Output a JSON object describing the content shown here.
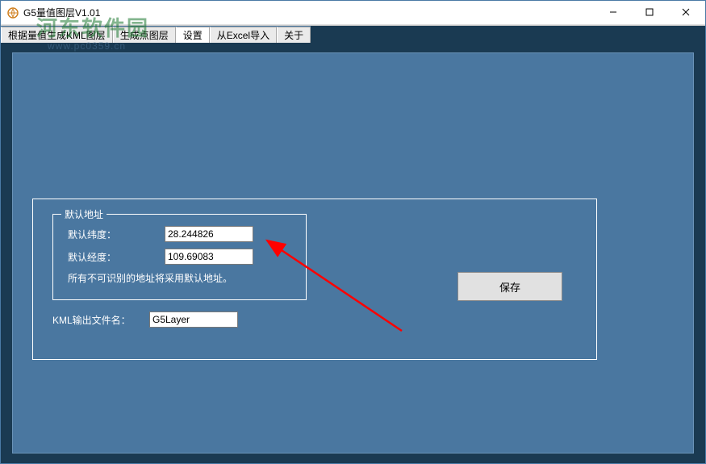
{
  "window": {
    "title": "G5量值图层V1.01"
  },
  "tabs": [
    {
      "label": "根据量值生成KML图层",
      "active": false
    },
    {
      "label": "生成点图层",
      "active": false
    },
    {
      "label": "设置",
      "active": true
    },
    {
      "label": "从Excel导入",
      "active": false
    },
    {
      "label": "关于",
      "active": false
    }
  ],
  "settings": {
    "fieldset_title": "默认地址",
    "latitude_label": "默认纬度：",
    "latitude_value": "28.244826",
    "longitude_label": "默认经度：",
    "longitude_value": "109.69083",
    "hint": "所有不可识别的地址将采用默认地址。",
    "output_label": "KML输出文件名：",
    "output_value": "G5Layer",
    "save_button": "保存"
  },
  "watermark": {
    "main": "河东软件园",
    "sub": "www.pc0359.cn"
  }
}
